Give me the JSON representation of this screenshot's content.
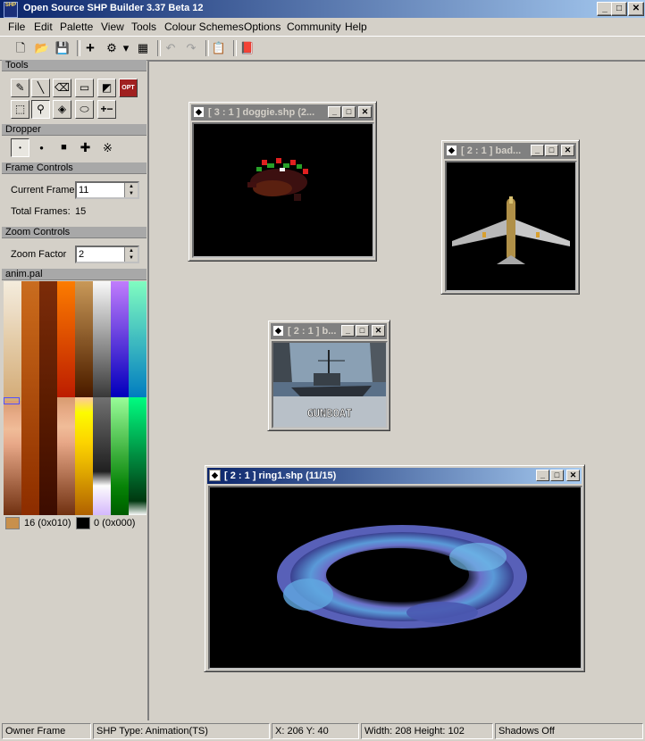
{
  "app": {
    "title": "Open Source SHP Builder 3.37 Beta 12",
    "icon_text": "SHP"
  },
  "caption_buttons": {
    "minimize": "_",
    "maximize": "□",
    "close": "✕"
  },
  "menu": [
    "File",
    "Edit",
    "Palette",
    "View",
    "Tools",
    "Colour Schemes",
    "Options",
    "Community",
    "Help"
  ],
  "toolbar": {
    "new": "🗋",
    "open": "📂",
    "save": "💾",
    "add": "+",
    "effects": "⚙",
    "dropdown": "▾",
    "preview": "▦",
    "undo": "↶",
    "redo": "↷",
    "properties": "📋",
    "book": "📕"
  },
  "tools": {
    "header": "Tools",
    "buttons": [
      {
        "name": "pencil",
        "glyph": "✎"
      },
      {
        "name": "line",
        "glyph": "╲"
      },
      {
        "name": "eraser",
        "glyph": "⌫"
      },
      {
        "name": "rectangle",
        "glyph": "▭"
      },
      {
        "name": "dark-light",
        "glyph": "◩"
      },
      {
        "name": "opt",
        "glyph": "OPT"
      },
      {
        "name": "select",
        "glyph": "⬚"
      },
      {
        "name": "dropper",
        "glyph": "⚲"
      },
      {
        "name": "fill",
        "glyph": "◈"
      },
      {
        "name": "ellipse",
        "glyph": "⬭"
      },
      {
        "name": "crash",
        "glyph": "+−"
      }
    ]
  },
  "dropper": {
    "header": "Dropper",
    "sizes": [
      {
        "glyph": "•"
      },
      {
        "glyph": "●"
      },
      {
        "glyph": "■"
      },
      {
        "glyph": "✚"
      },
      {
        "glyph": "※"
      }
    ]
  },
  "frame_controls": {
    "header": "Frame Controls",
    "current_label": "Current Frame",
    "current_value": "11",
    "total_label": "Total Frames:",
    "total_value": "15"
  },
  "zoom_controls": {
    "header": "Zoom Controls",
    "label": "Zoom Factor",
    "value": "2"
  },
  "palette": {
    "header": "anim.pal",
    "colors": [
      [
        "#f4ecdc",
        "#ecdcc4",
        "#e4cca8",
        "#dcbc90",
        "#d4ac78",
        "#cc9c64",
        "#c48c50",
        "#bc7c40",
        "#b46c34"
      ],
      [
        "#c86c20",
        "#c46418",
        "#bc5c14",
        "#b45410",
        "#ac4c0c",
        "#a44408",
        "#9c3c04",
        "#943400",
        "#8c2c00"
      ],
      [
        "#7c2c08",
        "#742808",
        "#6c2404",
        "#642004",
        "#5c1c00",
        "#541800",
        "#4c1400",
        "#441000",
        "#3c0c00"
      ],
      [
        "#fc7c00",
        "#f47000",
        "#ec6400",
        "#e45800",
        "#dc4c00",
        "#d44000",
        "#cc3400",
        "#c42800",
        "#bc1c00"
      ],
      [
        "#c89858",
        "#b8884c",
        "#a87840",
        "#986834",
        "#885828",
        "#78481c",
        "#683810",
        "#582804",
        "#481800"
      ],
      [
        "#f8f8f8",
        "#e0e0e0",
        "#c8c8c8",
        "#b0b0b0",
        "#989898",
        "#808080",
        "#686868",
        "#505050",
        "#383838"
      ],
      [
        "#c07cfc",
        "#a86cf4",
        "#905cec",
        "#784ce4",
        "#603cdc",
        "#482cd4",
        "#301ccc",
        "#180cc4",
        "#0000bc"
      ],
      [
        "#80fcc0",
        "#70ecc0",
        "#60dcc0",
        "#50ccc0",
        "#40bcc0",
        "#30acc0",
        "#209cc0",
        "#108cc0",
        "#007cc0"
      ]
    ],
    "lower": [
      [
        "#d89c70",
        "#e8ac88",
        "#f0bc98",
        "#e8a888",
        "#d09070",
        "#b87858",
        "#a06040",
        "#884828",
        "#703010"
      ],
      [
        "#fcc8a0",
        "#fcfc00",
        "#fce800",
        "#fcd400",
        "#f0c000",
        "#e0a800",
        "#d09000",
        "#c07800",
        "#b06000"
      ],
      [
        "#707070",
        "#606060",
        "#505050",
        "#404040",
        "#303030",
        "#202020",
        "#fcfcfc",
        "#e8d8fc",
        "#d4b8fc"
      ],
      [
        "#98fc98",
        "#80e880",
        "#68d468",
        "#50c050",
        "#38ac38",
        "#209820",
        "#088408",
        "#007000",
        "#005c00"
      ],
      [
        "#00fc80",
        "#00e070",
        "#00c460",
        "#00a850",
        "#008c40",
        "#007030",
        "#005420",
        "#003810",
        "#fcfcfc"
      ]
    ],
    "primary_swatch": {
      "color": "#c8904c",
      "label": "16 (0x010)"
    },
    "secondary_swatch": {
      "color": "#000000",
      "label": "0 (0x000)"
    }
  },
  "windows": [
    {
      "title": "[ 3 : 1 ] doggie.shp (2...",
      "active": false,
      "caption": "doggie"
    },
    {
      "title": "[ 2 : 1 ] bad...",
      "active": false,
      "caption": "plane"
    },
    {
      "title": "[ 2 : 1 ] b...",
      "active": false,
      "caption": "gunboat",
      "sprite_text": "GUNBOAT"
    },
    {
      "title": "[ 2 : 1 ] ring1.shp (11/15)",
      "active": true,
      "caption": "ring"
    }
  ],
  "status": {
    "owner": "Owner Frame",
    "shp_type": "SHP Type: Animation(TS)",
    "coords": "X: 206 Y: 40",
    "size": "Width: 208 Height: 102",
    "shadows": "Shadows Off"
  }
}
